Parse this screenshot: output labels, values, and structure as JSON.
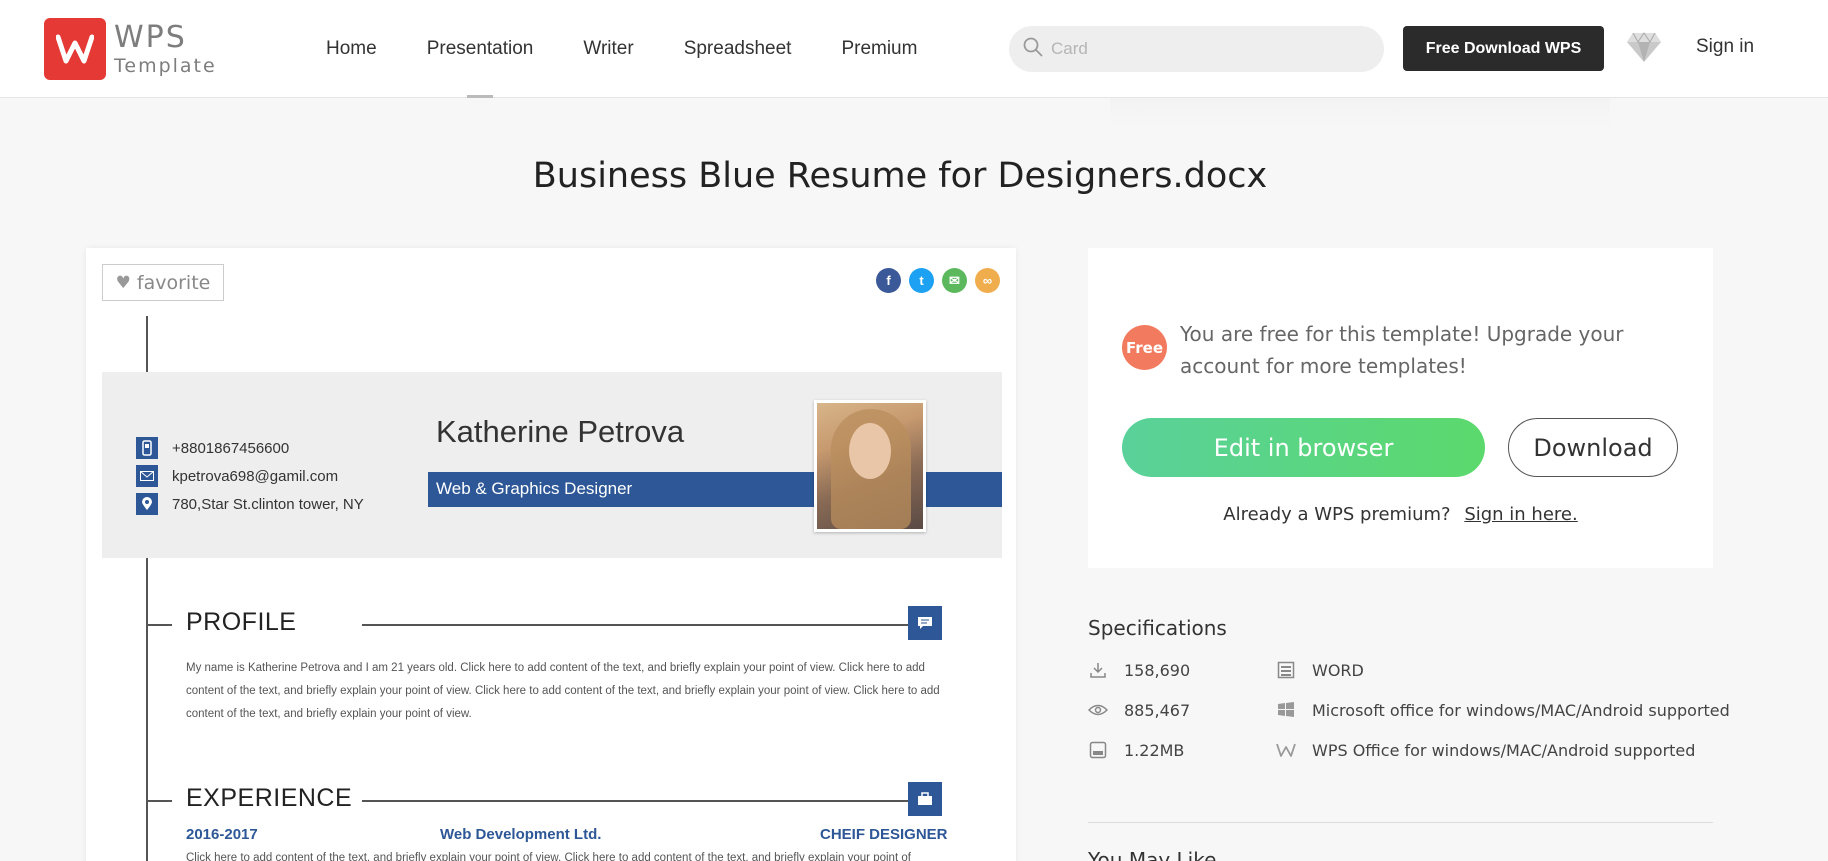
{
  "header": {
    "logo": {
      "wordmark": "WPS",
      "subtitle": "Template"
    },
    "nav": [
      "Home",
      "Presentation",
      "Writer",
      "Spreadsheet",
      "Premium"
    ],
    "search_placeholder": "Card",
    "free_download_label": "Free Download WPS",
    "sign_in_label": "Sign in"
  },
  "page_title": "Business Blue Resume for Designers.docx",
  "preview": {
    "favorite_label": "favorite",
    "share": [
      {
        "icon": "facebook-icon",
        "glyph": "f",
        "color": "#3b5998"
      },
      {
        "icon": "twitter-icon",
        "glyph": "t",
        "color": "#1da1f2"
      },
      {
        "icon": "email-icon",
        "glyph": "✉",
        "color": "#5cb85c"
      },
      {
        "icon": "link-icon",
        "glyph": "∞",
        "color": "#f0ad4e"
      }
    ],
    "resume": {
      "phone": "+8801867456600",
      "email": "kpetrova698@gamil.com",
      "address": "780,Star St.clinton tower, NY",
      "name": "Katherine Petrova",
      "role": "Web & Graphics Designer",
      "profile_title": "PROFILE",
      "profile_text": "My name is Katherine Petrova and I am 21 years old. Click here to add content of the text, and briefly explain your point of view. Click here to add content of the text, and briefly explain your point of view. Click here to add content of the text, and briefly explain your point of view. Click here to add content of the text, and briefly explain your point of view.",
      "experience_title": "EXPERIENCE",
      "exp_years": "2016-2017",
      "exp_company": "Web Development Ltd.",
      "exp_position": "CHEIF DESIGNER",
      "exp_text": "Click here to add content of the text, and briefly explain your point of view. Click here to add content of the text, and briefly explain your point of"
    }
  },
  "panel": {
    "free_badge": "Free",
    "free_message": "You are free for this template! Upgrade your account for more templates!",
    "edit_label": "Edit in browser",
    "download_label": "Download",
    "already_text": "Already a WPS premium?",
    "sign_in_here": "Sign in here."
  },
  "specs": {
    "title": "Specifications",
    "downloads": "158,690",
    "views": "885,467",
    "size": "1.22MB",
    "format": "WORD",
    "ms_support": "Microsoft office for windows/MAC/Android supported",
    "wps_support": "WPS Office for windows/MAC/Android supported"
  },
  "may_like": "You May Like"
}
